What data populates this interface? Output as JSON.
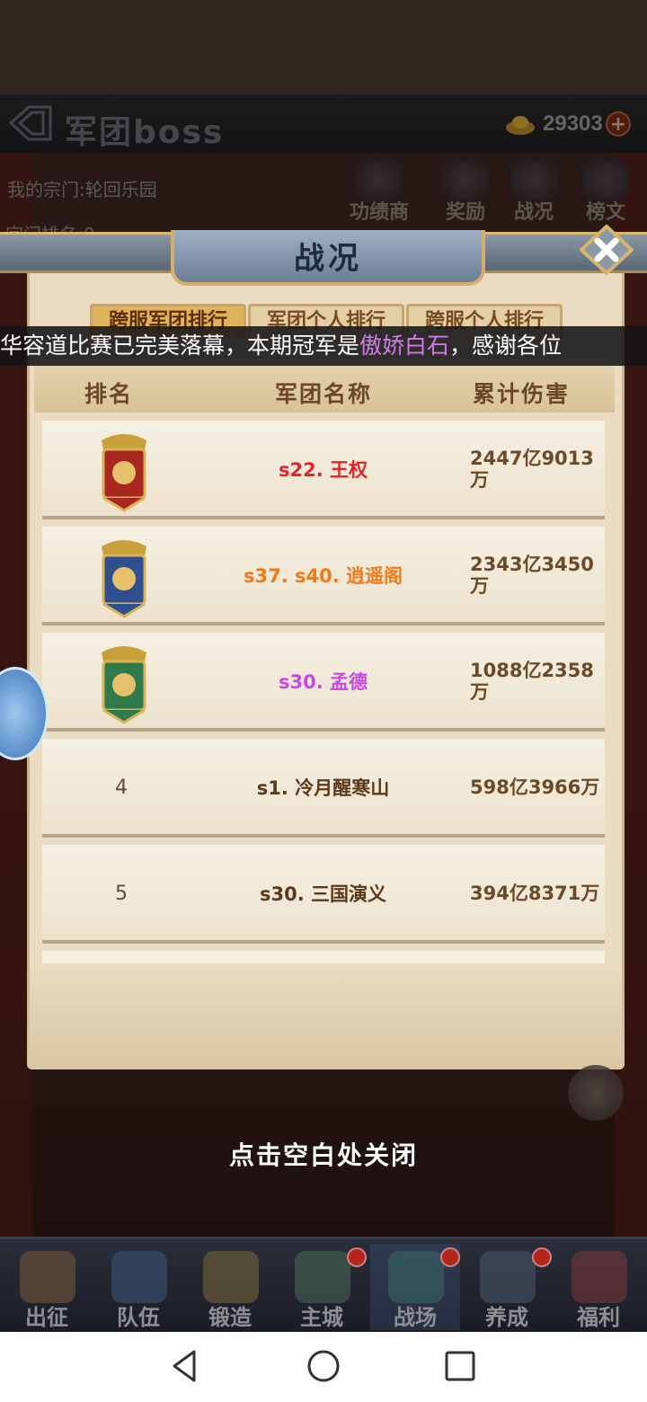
{
  "header": {
    "title": "军团boss",
    "currency_value": "29303",
    "currency_plus": "+"
  },
  "guild_info": {
    "my_sect": "我的宗门:轮回乐园",
    "sect_rank": "宗门排名:0"
  },
  "top_menu": [
    {
      "label": "功绩商店",
      "icon": "shop-icon"
    },
    {
      "label": "奖励",
      "icon": "reward-icon"
    },
    {
      "label": "战况",
      "icon": "scroll-icon"
    },
    {
      "label": "榜文",
      "icon": "notice-icon"
    }
  ],
  "panel": {
    "title": "战况",
    "tabs": [
      {
        "label": "跨服军团排行",
        "active": true
      },
      {
        "label": "军团个人排行",
        "active": false
      },
      {
        "label": "跨服个人排行",
        "active": false
      }
    ],
    "columns": [
      "排名",
      "军团名称",
      "累计伤害"
    ],
    "rows": [
      {
        "rank": "1",
        "name": "s22. 王权",
        "damage": "2447亿9013万",
        "name_color": "#e0262a",
        "badge_color": "#a8281f"
      },
      {
        "rank": "2",
        "name": "s37. s40. 逍遥阁",
        "damage": "2343亿3450万",
        "name_color": "#f07a1a",
        "badge_color": "#2f4f8f"
      },
      {
        "rank": "3",
        "name": "s30. 孟德",
        "damage": "1088亿2358万",
        "name_color": "#c44ae0",
        "badge_color": "#2f7a4a"
      },
      {
        "rank": "4",
        "name": "s1. 冷月醒寒山",
        "damage": "598亿3966万",
        "name_color": "#5a3a1a",
        "badge_color": ""
      },
      {
        "rank": "5",
        "name": "s30. 三国演义",
        "damage": "394亿8371万",
        "name_color": "#5a3a1a",
        "badge_color": ""
      }
    ],
    "close_hint": "点击空白处关闭"
  },
  "marquee": {
    "text_before": "华容道比赛已完美落幕，本期冠军是",
    "highlight": "傲娇白石",
    "text_after": "，感谢各位"
  },
  "bottom_nav": [
    {
      "label": "出征",
      "dot": false,
      "active": false,
      "icon": "battle-icon"
    },
    {
      "label": "队伍",
      "dot": false,
      "active": false,
      "icon": "team-icon"
    },
    {
      "label": "锻造",
      "dot": false,
      "active": false,
      "icon": "forge-icon"
    },
    {
      "label": "主城",
      "dot": true,
      "active": false,
      "icon": "city-icon"
    },
    {
      "label": "战场",
      "dot": true,
      "active": true,
      "icon": "battlefield-icon"
    },
    {
      "label": "养成",
      "dot": true,
      "active": false,
      "icon": "develop-icon"
    },
    {
      "label": "福利",
      "dot": false,
      "active": false,
      "icon": "welfare-icon"
    }
  ],
  "colors": {
    "accent_gold": "#d5b06a",
    "marquee_highlight": "#d27ae8",
    "notification_red": "#b2261d"
  }
}
